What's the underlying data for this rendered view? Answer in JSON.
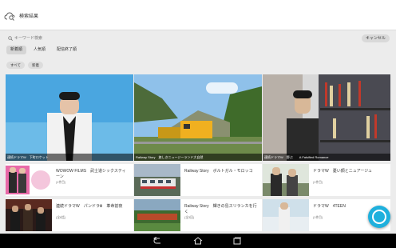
{
  "app": {
    "title": "検索結果"
  },
  "search": {
    "placeholder": "キーワード検索",
    "cancel_label": "キャンセル"
  },
  "tabs": [
    {
      "label": "新着順",
      "active": true
    },
    {
      "label": "人気順",
      "active": false
    },
    {
      "label": "配信終了順",
      "active": false
    }
  ],
  "filters": [
    {
      "label": "すべて"
    },
    {
      "label": "新着"
    }
  ],
  "featured": [
    {
      "caption": "連続ドラマW　下町ロケット"
    },
    {
      "caption": "Railway Story　旅しきニュージーランド大自然"
    },
    {
      "caption": "連続ドラマW　野ぶ　　A Falsified Romance"
    }
  ],
  "cards": [
    {
      "title": "WOWOW FILMS　武士道シックスティーン",
      "count": "(1件目)"
    },
    {
      "title": "Railway Story　ボルトガル・モロッコ",
      "count": ""
    },
    {
      "title": "ドラマW　憂い顔とニュアージュ",
      "count": "(1件目)"
    },
    {
      "title": "連続ドラマW　パンドラⅢ　革命前夜",
      "count": "(全8話)"
    },
    {
      "title": "Railway Story　輝きの島スリランカを行く",
      "count": "(全3回)"
    },
    {
      "title": "ドラマW　4TEEN",
      "count": "(1件目)"
    }
  ],
  "colors": {
    "accent": "#1eb0dd",
    "appbar": "#ffffff",
    "background": "#ececec",
    "navbar": "#000000"
  },
  "icons": {
    "app_logo": "cloud-search-icon",
    "search": "search-icon",
    "fab": "fab-circle-icon",
    "nav": [
      "back-icon",
      "home-icon",
      "recents-icon"
    ]
  }
}
